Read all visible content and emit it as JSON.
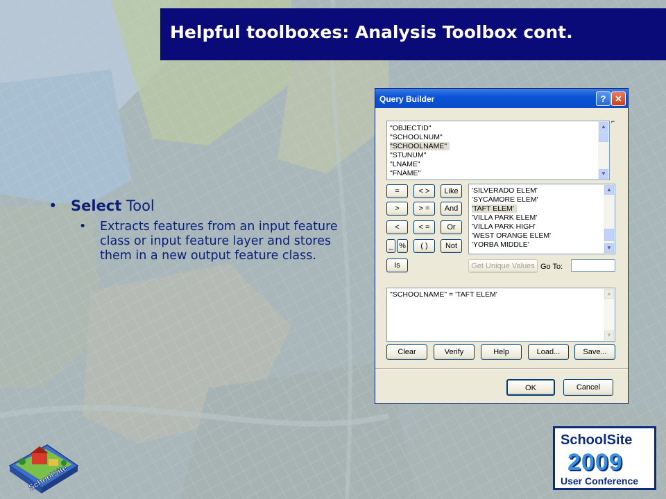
{
  "slide": {
    "title": "Helpful toolboxes: Analysis Toolbox cont.",
    "bullet1_strong": "Select",
    "bullet1_rest": " Tool",
    "bullet2": "Extracts features from an input feature class or input feature layer and stores them in a new output feature class.",
    "bullet_glyph": "•"
  },
  "dialog": {
    "title": "Query Builder",
    "help_glyph": "?",
    "close_glyph": "✕",
    "fields": [
      "\"OBJECTID\"",
      "\"SCHOOLNUM\"",
      "\"SCHOOLNAME\"",
      "\"STUNUM\"",
      "\"LNAME\"",
      "\"FNAME\""
    ],
    "selected_field": "\"SCHOOLNAME\"",
    "operators": [
      "=",
      "< >",
      "Like",
      ">",
      "> =",
      "And",
      "<",
      "< =",
      "Or",
      "_",
      "%",
      "( )",
      "Not",
      "Is"
    ],
    "values": [
      "'SILVERADO ELEM'",
      "'SYCAMORE ELEM'",
      "'TAFT ELEM'",
      "'VILLA PARK ELEM'",
      "'VILLA PARK HIGH'",
      "'WEST ORANGE ELEM'",
      "'YORBA MIDDLE'"
    ],
    "selected_value": "'TAFT ELEM'",
    "get_unique_values": "Get Unique Values",
    "goto_label": "Go To:",
    "goto_value": "",
    "expression": "\"SCHOOLNAME\" = 'TAFT ELEM'",
    "buttons": {
      "clear": "Clear",
      "verify": "Verify",
      "help": "Help",
      "load": "Load...",
      "save": "Save...",
      "ok": "OK",
      "cancel": "Cancel"
    }
  },
  "logos": {
    "left_text": "SchoolSite",
    "right_line1": "SchoolSite",
    "right_line2": "2009",
    "right_line3": "User Conference"
  },
  "colors": {
    "title_bg": "#0a0a78",
    "text_blue": "#0b1f7a",
    "dialog_title": "#0b54d6"
  }
}
